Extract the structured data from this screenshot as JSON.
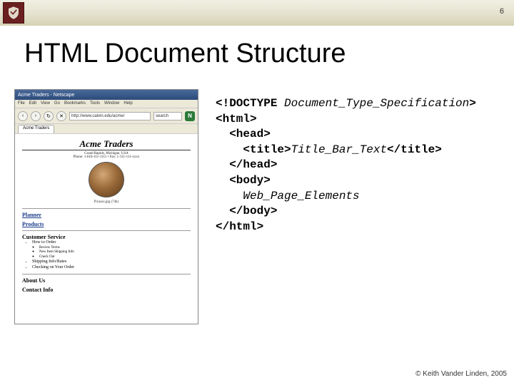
{
  "page_number": "6",
  "slide_title": "HTML Document Structure",
  "browser": {
    "titlebar": "Acme Traders - Netscape",
    "menus": [
      "File",
      "Edit",
      "View",
      "Go",
      "Bookmarks",
      "Tools",
      "Window",
      "Help"
    ],
    "url": "http://www.calvin.edu/acme/",
    "search_label": "search",
    "tab_label": "Acme Traders",
    "page": {
      "heading": "Acme Traders",
      "subheading": "Grand Rapids, Michigan, USA",
      "contact_line": "Phone: 1-616-111-1111 • Fax: 1-111-111-xxxx",
      "image_caption": "Picasso.jpg (74k)",
      "link_planner": "Planner",
      "link_products": "Products",
      "cs_heading": "Customer Service",
      "cs_items": [
        "How to Order",
        "Shipping Info/Rates",
        "Checking on Your Order"
      ],
      "cs_sub": [
        "Review Terms",
        "New Item Shipping Info",
        "Check Out"
      ],
      "about": "About Us",
      "contact": "Contact Info"
    }
  },
  "code": {
    "l1a": "<!DOCTYPE ",
    "l1b": "Document_Type_Specification",
    "l1c": ">",
    "l2": "<html>",
    "l3": "  <head>",
    "l4a": "    <title>",
    "l4b": "Title_Bar_Text",
    "l4c": "</title>",
    "l5": "  </head>",
    "l6": "  <body>",
    "l7": "    Web_Page_Elements",
    "l8": "  </body>",
    "l9": "</html>"
  },
  "copyright": "© Keith Vander Linden, 2005"
}
